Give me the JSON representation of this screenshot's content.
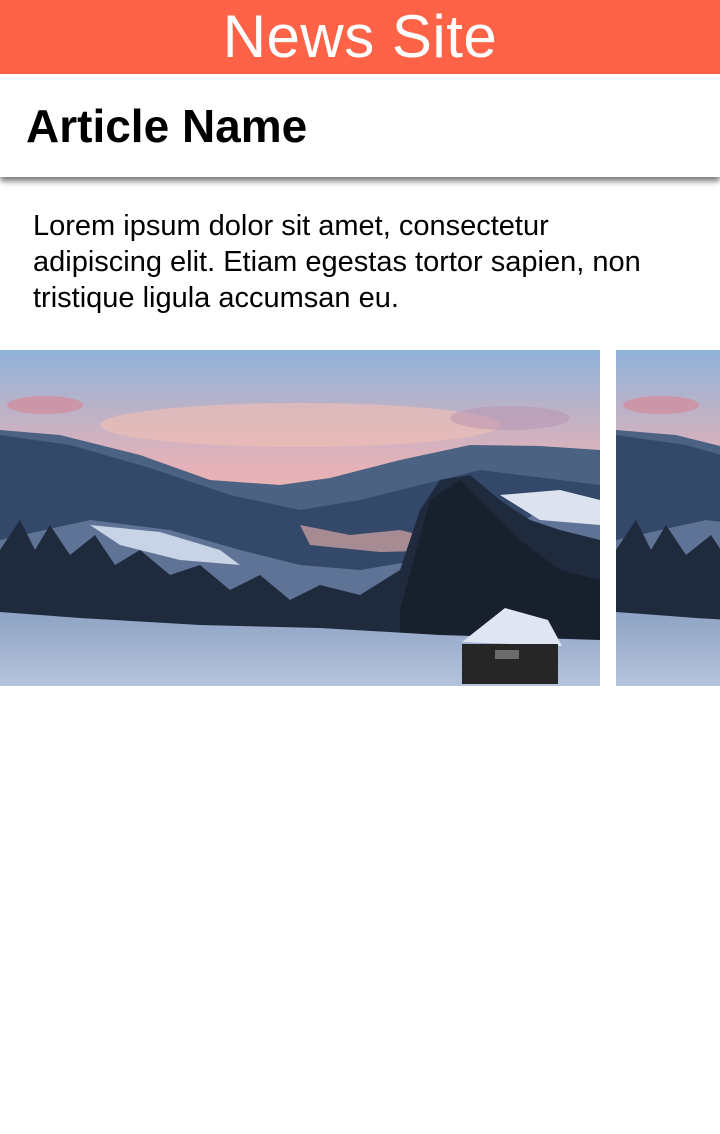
{
  "header": {
    "site_title": "News Site",
    "background_color": "#ff6347"
  },
  "article": {
    "title": "Article Name",
    "body": "Lorem ipsum dolor sit amet, consectetur adipiscing elit. Etiam egestas tortor sapien, non tristique ligula accumsan eu."
  },
  "gallery": {
    "images": [
      {
        "subject": "snowy valley at dusk with cabin"
      },
      {
        "subject": "snowy valley at dusk with cabin"
      }
    ]
  }
}
